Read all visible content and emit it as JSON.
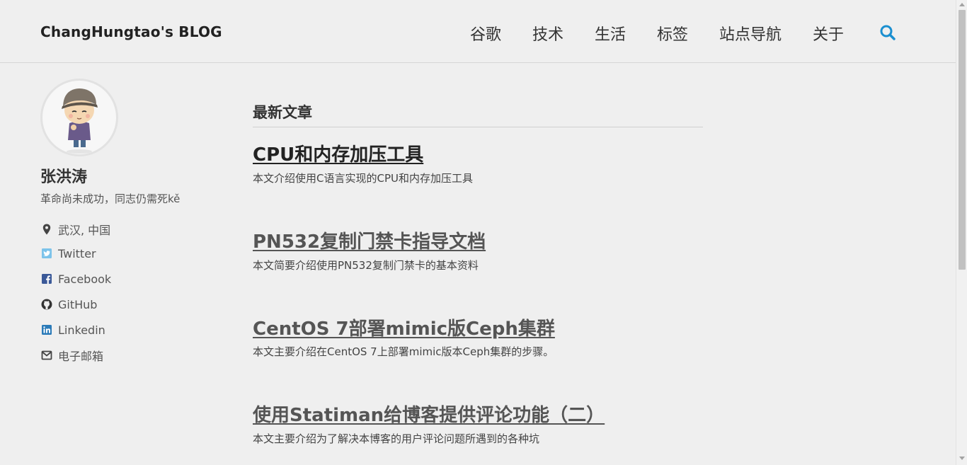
{
  "header": {
    "brand": "ChangHungtao's BLOG",
    "nav": [
      "谷歌",
      "技术",
      "生活",
      "标签",
      "站点导航",
      "关于"
    ],
    "search_icon": "search-icon",
    "accent_color": "#1a8fd0"
  },
  "sidebar": {
    "name": "张洪涛",
    "bio": "革命尚未成功，同志仍需死kě",
    "links": [
      {
        "icon": "location-pin-icon",
        "label": "武汉, 中国"
      },
      {
        "icon": "twitter-icon",
        "label": "Twitter"
      },
      {
        "icon": "facebook-icon",
        "label": "Facebook"
      },
      {
        "icon": "github-icon",
        "label": "GitHub"
      },
      {
        "icon": "linkedin-icon",
        "label": "Linkedin"
      },
      {
        "icon": "email-icon",
        "label": "电子邮箱"
      }
    ]
  },
  "main": {
    "section_title": "最新文章",
    "posts": [
      {
        "title": "CPU和内存加压工具",
        "excerpt": "本文介绍使用C语言实现的CPU和内存加压工具"
      },
      {
        "title": "PN532复制门禁卡指导文档",
        "excerpt": "本文简要介绍使用PN532复制门禁卡的基本资料"
      },
      {
        "title": "CentOS 7部署mimic版Ceph集群",
        "excerpt": "本文主要介绍在CentOS 7上部署mimic版本Ceph集群的步骤。"
      },
      {
        "title": "使用Statiman给博客提供评论功能（二）",
        "excerpt": "本文主要介绍为了解决本博客的用户评论问题所遇到的各种坑"
      }
    ]
  }
}
